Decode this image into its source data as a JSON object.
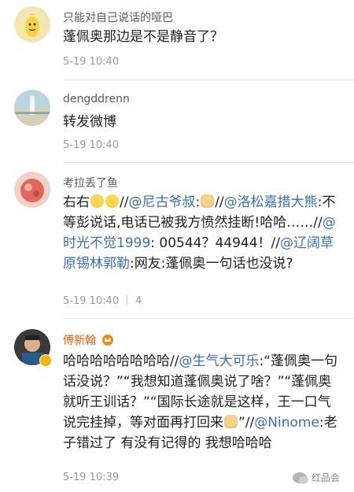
{
  "comments": [
    {
      "username": "只能对自己说话的哑巴",
      "text": "蓬佩奥那边是不是静音了？",
      "time": "5-19 10:40",
      "avatar_color": "#f3e6b0"
    },
    {
      "username": "dengddrenn",
      "text": "转发微博",
      "time": "5-19 10:40",
      "avatar_color": "#a9c9d8"
    },
    {
      "username": "考拉丢了鱼",
      "time": "5-19 10:40",
      "reply_count": "4",
      "avatar_color": "#e98b7b",
      "segments": {
        "s1": "右右",
        "s2": "//",
        "s3": "@尼古爷叔",
        "s4": ":",
        "s5": "//",
        "s6": "@洛松嘉措大熊",
        "s7": ":不等彭说话,电话已被我方愤然挂断!哈哈……//",
        "s8": "@时光不觉1999",
        "s9": ": 00544？44944！//",
        "s10": "@辽阔草原锡林郭勒",
        "s11": ":网友:蓬佩奥一句话也没说?"
      }
    },
    {
      "username": "傅新翰",
      "time": "5-19 10:39",
      "avatar_color": "#c9a080",
      "segments": {
        "s1": "哈哈哈哈哈哈哈哈",
        "s2": "//",
        "s3": "@生气大可乐",
        "s4": ":“蓬佩奥一句话没说？”“我想知道蓬佩奥说了啥？”“蓬佩奥就听王训话？”“国际长途就是这样，王一口气说完挂掉，等对面再打回来",
        "s5": "”//",
        "s6": "@Ninome",
        "s7": ":老子错过了 有没有记得的 我想哈哈哈"
      }
    }
  ],
  "watermark": "红品会",
  "colors": {
    "link": "#3b6fb6",
    "vip_name": "#e36210",
    "meta": "#9a9a9a"
  }
}
